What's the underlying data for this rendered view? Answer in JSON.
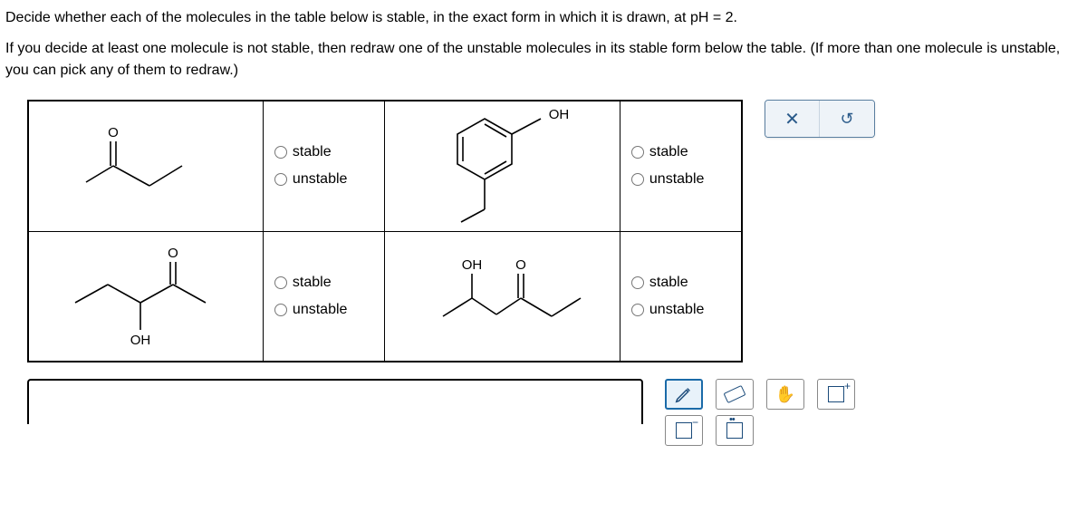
{
  "instructions": {
    "line1": "Decide whether each of the molecules in the table below is stable, in the exact form in which it is drawn, at pH = 2.",
    "line2": "If you decide at least one molecule is not stable, then redraw one of the unstable molecules in its stable form below the table. (If more than one molecule is unstable, you can pick any of them to redraw.)"
  },
  "options": {
    "stable": "stable",
    "unstable": "unstable"
  },
  "molecules": {
    "m1": {
      "oh": "O"
    },
    "m2": {
      "oh": "OH"
    },
    "m3": {
      "o": "O",
      "oh": "OH"
    },
    "m4": {
      "oh": "OH",
      "o": "O"
    }
  },
  "buttons": {
    "clear": "✕",
    "reset": "↺"
  }
}
